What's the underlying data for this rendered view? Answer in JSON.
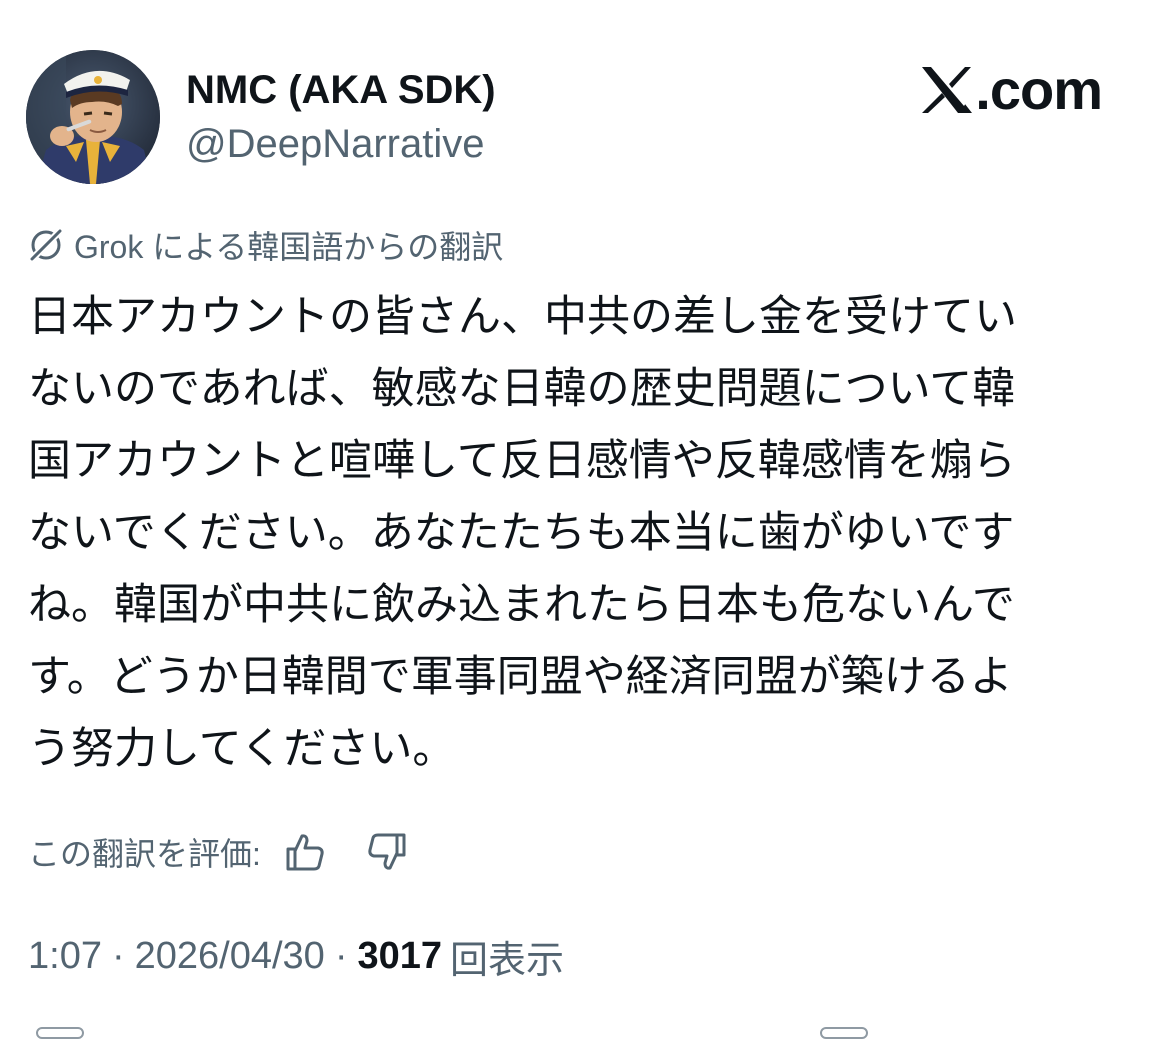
{
  "author": {
    "display_name": "NMC (AKA SDK)",
    "handle": "@DeepNarrative",
    "avatar_icon": "anime-character-avatar"
  },
  "brand": {
    "icon": "x-logo-icon",
    "text": ".com"
  },
  "translation": {
    "icon": "grok-icon",
    "label": "Grok による韓国語からの翻訳"
  },
  "post": {
    "text": "日本アカウントの皆さん、中共の差し金を受けてい\nないのであれば、敏感な日韓の歴史問題について韓\n国アカウントと喧嘩して反日感情や反韓感情を煽ら\nないでください。あなたたちも本当に歯がゆいです\nね。韓国が中共に飲み込まれたら日本も危ないんで\nす。どうか日韓間で軍事同盟や経済同盟が築けるよ\nう努力してください。"
  },
  "rating": {
    "label": "この翻訳を評価:",
    "up_icon": "thumbs-up-icon",
    "down_icon": "thumbs-down-icon"
  },
  "meta": {
    "time": "1:07",
    "separator": "·",
    "date": "2026/04/30",
    "views_count": "3017",
    "views_label": "回表示"
  },
  "colors": {
    "text_primary": "#0f1419",
    "text_secondary": "#536471",
    "background": "#ffffff"
  }
}
